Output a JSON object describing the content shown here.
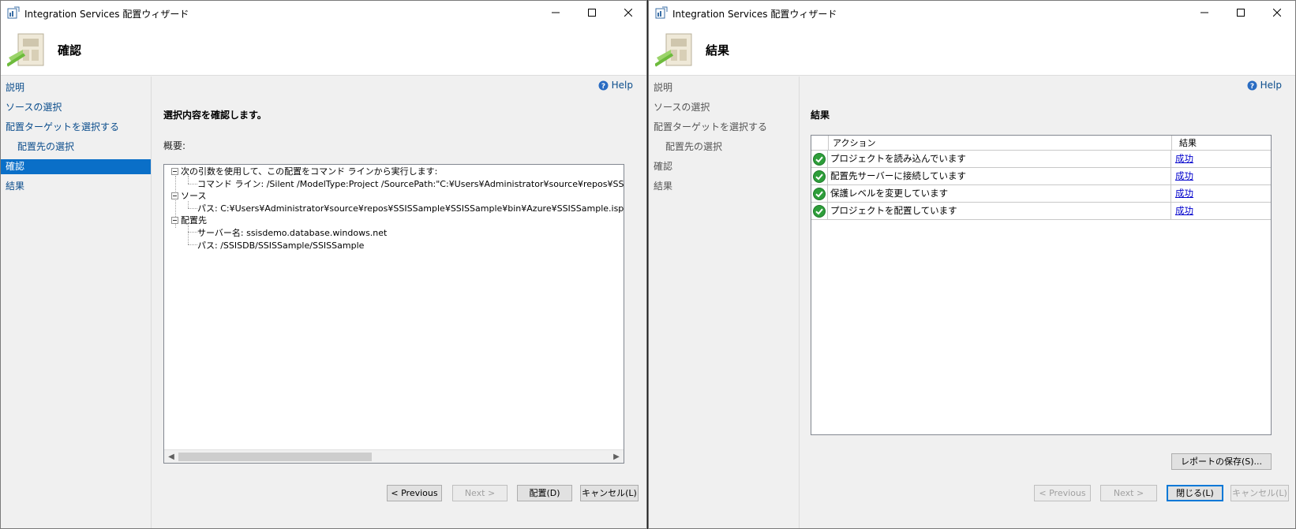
{
  "left_window": {
    "title": "Integration Services 配置ウィザード",
    "heading": "確認",
    "help_label": "Help",
    "nav": [
      {
        "label": "説明"
      },
      {
        "label": "ソースの選択"
      },
      {
        "label": "配置ターゲットを選択する"
      },
      {
        "label": "配置先の選択"
      },
      {
        "label": "確認"
      },
      {
        "label": "結果"
      }
    ],
    "section_title": "選択内容を確認します。",
    "summary_label": "概要:",
    "tree": {
      "command_group": "次の引数を使用して、この配置をコマンド ラインから実行します:",
      "command_line": "コマンド ライン: /Silent /ModelType:Project /SourcePath:\"C:¥Users¥Administrator¥source¥repos¥SSISSample¥SSI",
      "source_group": "ソース",
      "source_path": "パス: C:¥Users¥Administrator¥source¥repos¥SSISSample¥SSISSample¥bin¥Azure¥SSISSample.ispac",
      "dest_group": "配置先",
      "dest_server": "サーバー名: ssisdemo.database.windows.net",
      "dest_path": "パス: /SSISDB/SSISSample/SSISSample"
    },
    "buttons": {
      "previous": "< Previous",
      "next": "Next >",
      "deploy": "配置(D)",
      "cancel": "キャンセル(L)"
    }
  },
  "right_window": {
    "title": "Integration Services 配置ウィザード",
    "heading": "結果",
    "help_label": "Help",
    "nav": [
      {
        "label": "説明"
      },
      {
        "label": "ソースの選択"
      },
      {
        "label": "配置ターゲットを選択する"
      },
      {
        "label": "配置先の選択"
      },
      {
        "label": "確認"
      },
      {
        "label": "結果"
      }
    ],
    "section_title": "結果",
    "grid": {
      "col_action": "アクション",
      "col_result": "結果",
      "rows": [
        {
          "action": "プロジェクトを読み込んでいます",
          "result": "成功"
        },
        {
          "action": "配置先サーバーに接続しています",
          "result": "成功"
        },
        {
          "action": "保護レベルを変更しています",
          "result": "成功"
        },
        {
          "action": "プロジェクトを配置しています",
          "result": "成功"
        }
      ]
    },
    "buttons": {
      "save_report": "レポートの保存(S)...",
      "previous": "< Previous",
      "next": "Next >",
      "close": "閉じる(L)",
      "cancel": "キャンセル(L)"
    }
  },
  "colors": {
    "accent": "#0a6fc8",
    "link": "#0b4d8c",
    "success": "#2e9e3a"
  }
}
